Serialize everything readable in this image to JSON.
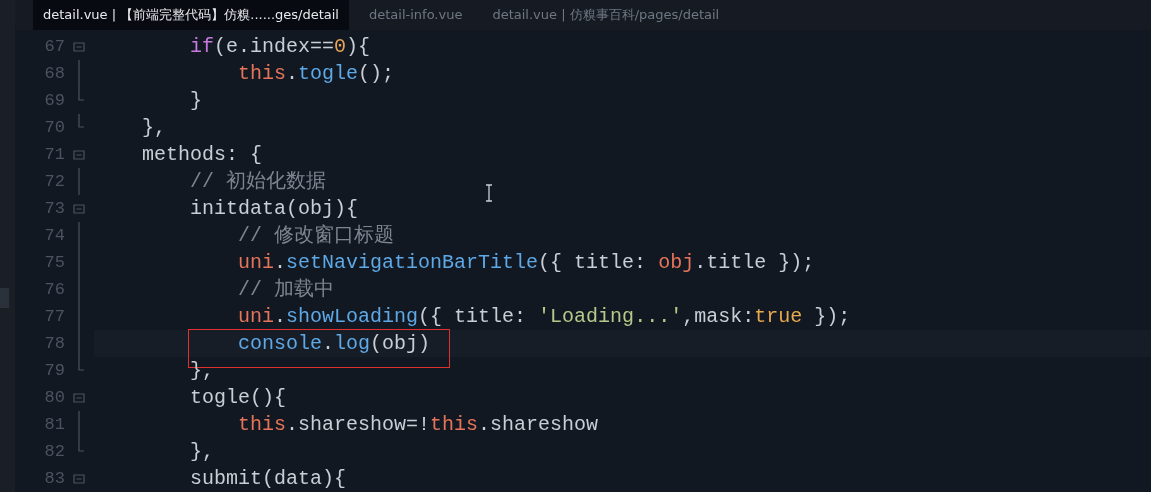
{
  "tabs": [
    {
      "label": "detail.vue | 【前端完整代码】仿糗......ges/detail",
      "selected": true
    },
    {
      "label": "detail-info.vue",
      "selected": false
    },
    {
      "label": "detail.vue | 仿糗事百科/pages/detail",
      "selected": false
    }
  ],
  "lines": [
    {
      "number": "67",
      "kind": "start",
      "current": false,
      "boxed": false,
      "tokens": [
        {
          "kind": "keyword",
          "text": "        if"
        },
        {
          "kind": "plain",
          "text": "(e.index=="
        },
        {
          "kind": "number",
          "text": "0"
        },
        {
          "kind": "plain",
          "text": "){"
        }
      ]
    },
    {
      "number": "68",
      "kind": "mid",
      "current": false,
      "boxed": false,
      "tokens": [
        {
          "kind": "self",
          "text": "            this"
        },
        {
          "kind": "plain",
          "text": "."
        },
        {
          "kind": "func",
          "text": "togle"
        },
        {
          "kind": "plain",
          "text": "();"
        }
      ]
    },
    {
      "number": "69",
      "kind": "end",
      "current": false,
      "boxed": false,
      "tokens": [
        {
          "kind": "plain",
          "text": "        }"
        }
      ]
    },
    {
      "number": "70",
      "kind": "end",
      "current": false,
      "boxed": false,
      "tokens": [
        {
          "kind": "plain",
          "text": "    },"
        }
      ]
    },
    {
      "number": "71",
      "kind": "start",
      "current": false,
      "boxed": false,
      "tokens": [
        {
          "kind": "plain",
          "text": "    methods: {"
        }
      ]
    },
    {
      "number": "72",
      "kind": "mid",
      "current": false,
      "boxed": false,
      "tokens": [
        {
          "kind": "comment",
          "text": "        // 初始化数据"
        }
      ]
    },
    {
      "number": "73",
      "kind": "start",
      "current": false,
      "boxed": false,
      "tokens": [
        {
          "kind": "plain",
          "text": "        initdata(obj){"
        }
      ]
    },
    {
      "number": "74",
      "kind": "mid",
      "current": false,
      "boxed": false,
      "tokens": [
        {
          "kind": "comment",
          "text": "            // 修改窗口标题"
        }
      ]
    },
    {
      "number": "75",
      "kind": "mid",
      "current": false,
      "boxed": false,
      "tokens": [
        {
          "kind": "self",
          "text": "            uni"
        },
        {
          "kind": "plain",
          "text": "."
        },
        {
          "kind": "func",
          "text": "setNavigationBarTitle"
        },
        {
          "kind": "plain",
          "text": "({ title: "
        },
        {
          "kind": "self",
          "text": "obj"
        },
        {
          "kind": "plain",
          "text": ".title });"
        }
      ]
    },
    {
      "number": "76",
      "kind": "mid",
      "current": false,
      "boxed": false,
      "tokens": [
        {
          "kind": "comment",
          "text": "            // 加载中"
        }
      ]
    },
    {
      "number": "77",
      "kind": "mid",
      "current": false,
      "boxed": false,
      "tokens": [
        {
          "kind": "self",
          "text": "            uni"
        },
        {
          "kind": "plain",
          "text": "."
        },
        {
          "kind": "func",
          "text": "showLoading"
        },
        {
          "kind": "plain",
          "text": "({ title: "
        },
        {
          "kind": "string",
          "text": "'Loading...'"
        },
        {
          "kind": "plain",
          "text": ",mask:"
        },
        {
          "kind": "bool",
          "text": "true"
        },
        {
          "kind": "plain",
          "text": " });"
        }
      ]
    },
    {
      "number": "78",
      "kind": "mid",
      "current": true,
      "boxed": true,
      "tokens": [
        {
          "kind": "func",
          "text": "            console"
        },
        {
          "kind": "plain",
          "text": "."
        },
        {
          "kind": "func",
          "text": "log"
        },
        {
          "kind": "plain",
          "text": "(obj)"
        }
      ]
    },
    {
      "number": "79",
      "kind": "end",
      "current": false,
      "boxed": false,
      "tokens": [
        {
          "kind": "plain",
          "text": "        },"
        }
      ]
    },
    {
      "number": "80",
      "kind": "start",
      "current": false,
      "boxed": false,
      "tokens": [
        {
          "kind": "plain",
          "text": "        togle(){"
        }
      ]
    },
    {
      "number": "81",
      "kind": "mid",
      "current": false,
      "boxed": false,
      "tokens": [
        {
          "kind": "self",
          "text": "            this"
        },
        {
          "kind": "plain",
          "text": ".shareshow=!"
        },
        {
          "kind": "self",
          "text": "this"
        },
        {
          "kind": "plain",
          "text": ".shareshow"
        }
      ]
    },
    {
      "number": "82",
      "kind": "end",
      "current": false,
      "boxed": false,
      "tokens": [
        {
          "kind": "plain",
          "text": "        },"
        }
      ]
    },
    {
      "number": "83",
      "kind": "start",
      "current": false,
      "boxed": false,
      "tokens": [
        {
          "kind": "plain",
          "text": "        submit(data){"
        }
      ]
    }
  ]
}
